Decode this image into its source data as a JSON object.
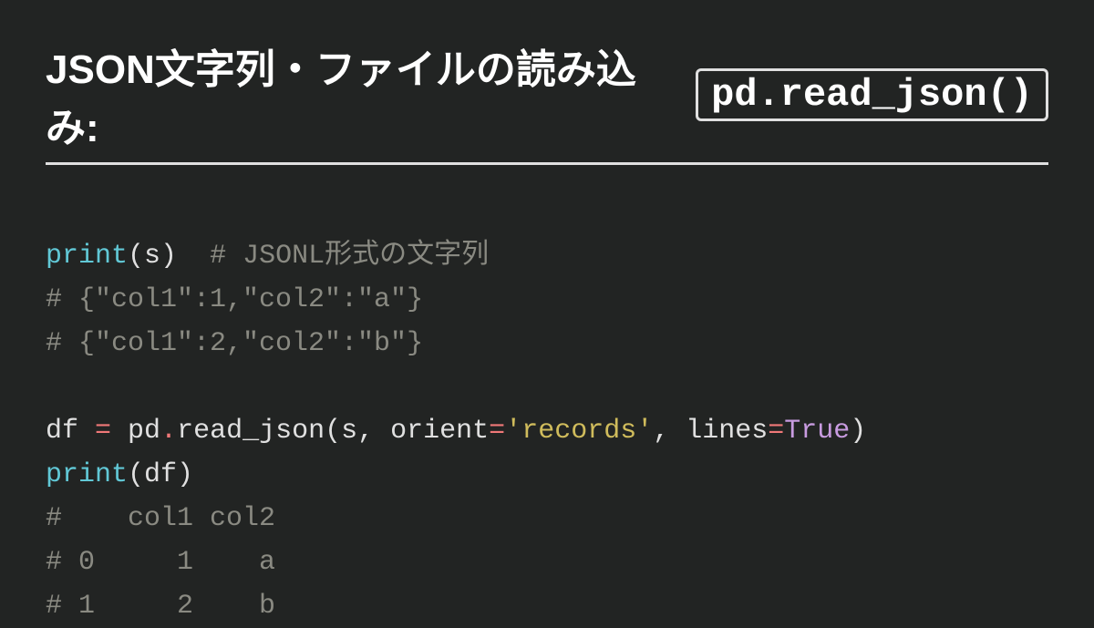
{
  "title": {
    "prefix": "JSON文字列・ファイルの読み込み:",
    "code": "pd.read_json()"
  },
  "code": {
    "line1": {
      "func": "print",
      "open": "(",
      "arg": "s",
      "close": ")",
      "pad": "  ",
      "comment": "# JSONL形式の文字列"
    },
    "line2": "# {\"col1\":1,\"col2\":\"a\"}",
    "line3": "# {\"col1\":2,\"col2\":\"b\"}",
    "blank": "",
    "line5": {
      "lhs": "df",
      "assign": " = ",
      "obj": "pd",
      "dot": ".",
      "method": "read_json",
      "open": "(",
      "arg1": "s",
      "comma1": ", ",
      "kw1": "orient",
      "eq1": "=",
      "val1": "'records'",
      "comma2": ", ",
      "kw2": "lines",
      "eq2": "=",
      "val2": "True",
      "close": ")"
    },
    "line6": {
      "func": "print",
      "open": "(",
      "arg": "df",
      "close": ")"
    },
    "line7": "#    col1 col2",
    "line8": "# 0     1    a",
    "line9": "# 1     2    b"
  }
}
